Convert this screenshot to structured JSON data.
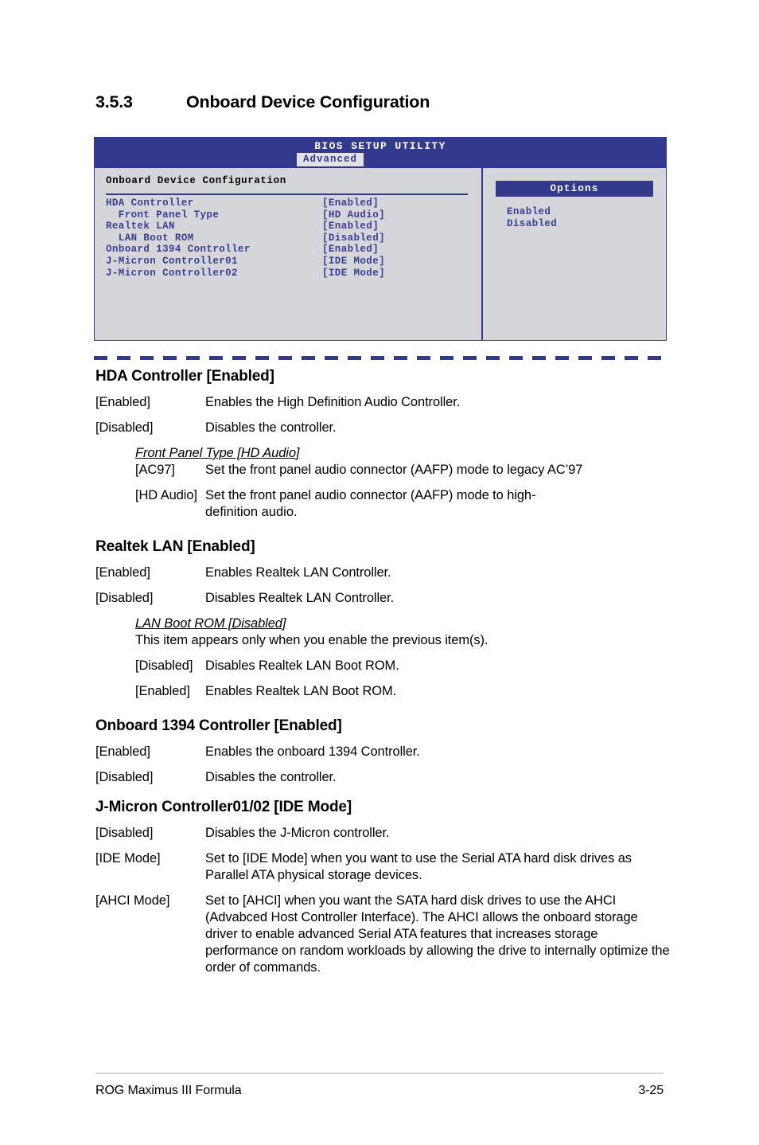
{
  "page": {
    "section_number": "3.5.3",
    "section_title": "Onboard Device Configuration"
  },
  "bios": {
    "title": "BIOS SETUP UTILITY",
    "active_tab": "Advanced",
    "panel_title": "Onboard Device Configuration",
    "menu_items": [
      {
        "label": "HDA Controller",
        "value": "[Enabled]"
      },
      {
        "label": "  Front Panel Type",
        "value": "[HD Audio]"
      },
      {
        "label": "Realtek LAN",
        "value": "[Enabled]"
      },
      {
        "label": "  LAN Boot ROM",
        "value": "[Disabled]"
      },
      {
        "label": "Onboard 1394 Controller",
        "value": "[Enabled]"
      },
      {
        "label": "J-Micron Controller01",
        "value": "[IDE Mode]"
      },
      {
        "label": "J-Micron Controller02",
        "value": "[IDE Mode]"
      }
    ],
    "options_header": "Options",
    "options": [
      "Enabled",
      "Disabled"
    ],
    "colors": {
      "header_bg": "#333a8e",
      "body_bg": "#d5d6da",
      "text_blue": "#3b3f92",
      "tab_bg": "#e2e2e6"
    }
  },
  "sections": {
    "hda": {
      "heading": "HDA Controller [Enabled]",
      "defs": [
        {
          "term": "[Enabled]",
          "desc": "Enables the High Definition Audio Controller."
        },
        {
          "term": "[Disabled]",
          "desc": "Disables the controller."
        }
      ],
      "sub": {
        "heading": "Front Panel Type [HD Audio]",
        "defs": [
          {
            "term": "[AC97]",
            "desc": "Set the front panel audio connector (AAFP) mode to legacy AC’97"
          },
          {
            "term": "[HD Audio]",
            "desc": "Set the front panel audio connector (AAFP) mode to high-"
          }
        ],
        "continuation": "definition audio."
      }
    },
    "realtek": {
      "heading": "Realtek LAN [Enabled]",
      "defs": [
        {
          "term": "[Enabled]",
          "desc": "Enables Realtek LAN Controller."
        },
        {
          "term": "[Disabled]",
          "desc": "Disables Realtek LAN Controller."
        }
      ],
      "sub": {
        "heading": "LAN Boot ROM [Disabled]",
        "note": "This item appears only when you enable the previous item(s).",
        "defs": [
          {
            "term": "[Disabled]",
            "desc": "Disables Realtek LAN Boot ROM."
          },
          {
            "term": "[Enabled]",
            "desc": "Enables Realtek LAN Boot ROM."
          }
        ]
      }
    },
    "onboard1394": {
      "heading": "Onboard 1394 Controller [Enabled]",
      "defs": [
        {
          "term": "[Enabled]",
          "desc": "Enables the onboard 1394 Controller."
        },
        {
          "term": "[Disabled]",
          "desc": "Disables the controller."
        }
      ]
    },
    "jmicron": {
      "heading": "J-Micron Controller01/02 [IDE Mode]",
      "defs": [
        {
          "term": "[Disabled]",
          "desc": "Disables the J-Micron controller."
        },
        {
          "term": "[IDE Mode]",
          "desc": "Set to [IDE Mode] when you want to use the Serial ATA hard disk drives as Parallel ATA physical storage devices."
        },
        {
          "term": "[AHCI Mode]",
          "desc": "Set to [AHCI] when you want the SATA hard disk drives to use the AHCI (Advabced Host Controller Interface). The AHCI allows the onboard storage driver to enable advanced Serial ATA features that increases storage performance on random workloads by allowing the drive to internally optimize the order of commands."
        }
      ]
    }
  },
  "footer": {
    "left": "ROG Maximus III Formula",
    "right": "3-25"
  }
}
